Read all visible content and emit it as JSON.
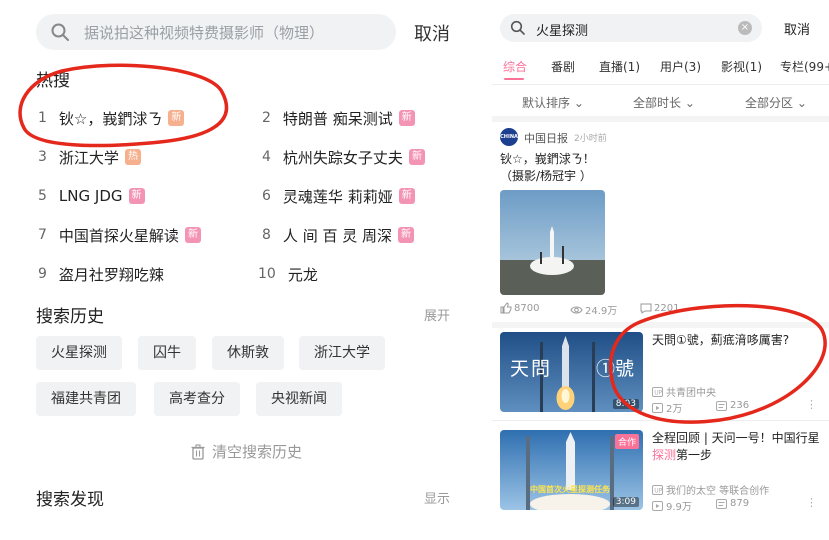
{
  "left": {
    "search_placeholder": "据说拍这种视频特费摄影师（物理）",
    "cancel": "取消",
    "hot_title": "热搜",
    "hot_items": [
      {
        "rank": "1",
        "text": "钬☆，峩鍆浗ㄋ",
        "tag": "新"
      },
      {
        "rank": "2",
        "text": "特朗普 痴呆测试",
        "tag": "新"
      },
      {
        "rank": "3",
        "text": "浙江大学",
        "tag": "热"
      },
      {
        "rank": "4",
        "text": "杭州失踪女子丈夫",
        "tag": "新"
      },
      {
        "rank": "5",
        "text": "LNG JDG",
        "tag": "新"
      },
      {
        "rank": "6",
        "text": "灵魂莲华 莉莉娅",
        "tag": "新"
      },
      {
        "rank": "7",
        "text": "中国首探火星解读",
        "tag": "新"
      },
      {
        "rank": "8",
        "text": "人 间 百 灵 周深",
        "tag": "新"
      },
      {
        "rank": "9",
        "text": "盗月社罗翔吃辣",
        "tag": ""
      },
      {
        "rank": "10",
        "text": "元龙",
        "tag": ""
      }
    ],
    "history_title": "搜索历史",
    "history_expand": "展开",
    "history_chips": [
      "火星探测",
      "囚牛",
      "休斯敦",
      "浙江大学",
      "福建共青团",
      "高考查分",
      "央视新闻"
    ],
    "clear_history": "清空搜索历史",
    "discover_title": "搜索发现",
    "discover_show": "显示"
  },
  "right": {
    "search_value": "火星探测",
    "cancel": "取消",
    "tabs": [
      "综合",
      "番剧",
      "直播(1)",
      "用户(3)",
      "影视(1)",
      "专栏(99+"
    ],
    "filters": [
      "默认排序",
      "全部时长",
      "全部分区"
    ],
    "post": {
      "author": "中国日报",
      "time": "2小时前",
      "logo_text": "CHINA DAILY",
      "line1": "钬☆，峩鍆浗ㄋ！",
      "line2": "（摄影/杨冠宇 ）",
      "likes": "8700",
      "views": "24.9万",
      "comments": "2201"
    },
    "videos": [
      {
        "title": "天問①號，薊疷湇哆厲害?",
        "thumb_text_left": "天問",
        "thumb_text_right": "①號",
        "duration": "8:03",
        "uploader": "共青团中央",
        "plays": "2万",
        "danmaku": "236",
        "badge": ""
      },
      {
        "title_pre": "全程回顾 | 天问一号！中国行星",
        "title_hl": "探测",
        "title_post": "第一步",
        "thumb_caption": "中国首次火星探测任务",
        "duration": "3:09",
        "uploader": "我们的太空 等联合创作",
        "plays": "9.9万",
        "danmaku": "879",
        "badge": "合作"
      }
    ]
  },
  "colors": {
    "accent": "#fb7299",
    "annotation": "#e4281b",
    "new_tag": "#f494b4",
    "hot_tag": "#f6b08e"
  },
  "icons": [
    "search-icon",
    "trash-icon",
    "clear-icon",
    "like-icon",
    "view-icon",
    "comment-icon",
    "upload-icon",
    "play-icon",
    "danmaku-icon",
    "more-icon",
    "chevron-down-icon"
  ]
}
